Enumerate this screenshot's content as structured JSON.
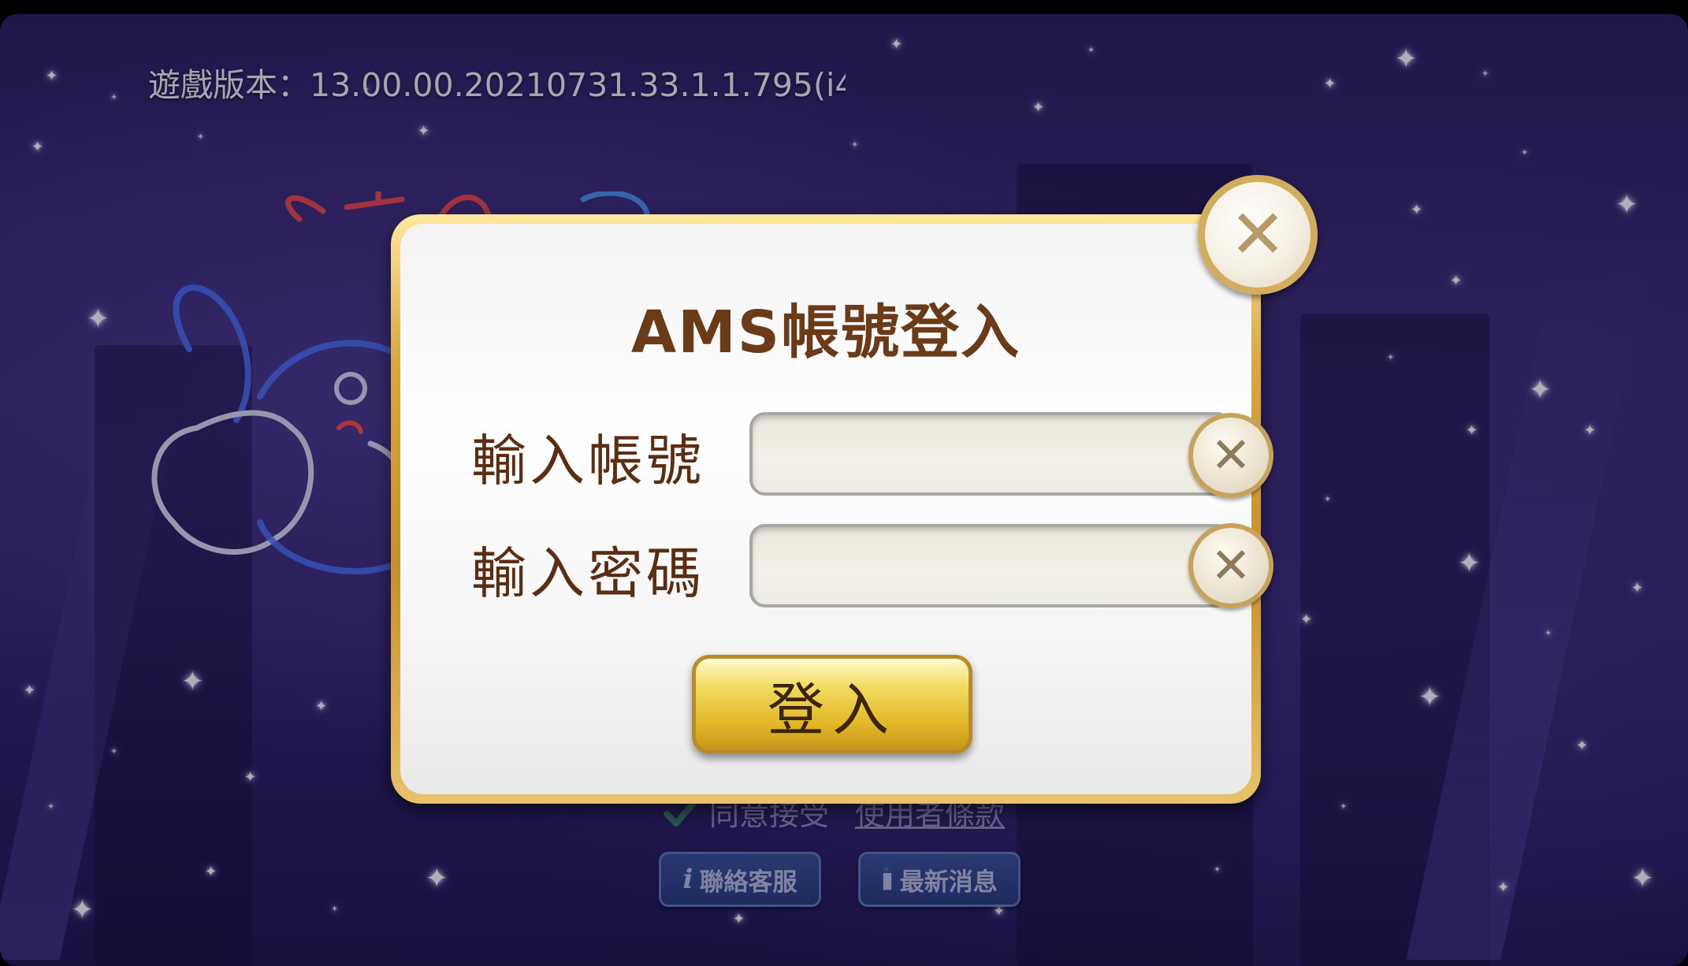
{
  "version": {
    "text": "遊戲版本：13.00.00.20210731.33.1.1.795(i4"
  },
  "background": {
    "agree_text": "同意接受",
    "terms_link": "使用者條款",
    "contact_button": {
      "icon": "info-icon",
      "label": "聯絡客服"
    },
    "news_button": {
      "icon": "book-icon",
      "label": "最新消息"
    }
  },
  "dialog": {
    "title": "AMS帳號登入",
    "account": {
      "label": "輸入帳號",
      "value": "",
      "clear_icon": "clear-x-icon"
    },
    "password": {
      "label": "輸入密碼",
      "value": "",
      "clear_icon": "clear-x-icon"
    },
    "login_button": {
      "label": "登入"
    },
    "close_icon": "close-x-icon"
  },
  "colors": {
    "title_brown": "#6b3a16",
    "label_brown": "#5b2e12",
    "frame_gold": "#d9a640",
    "button_gold": "#e3b828",
    "background_purple": "#3a2b72"
  }
}
